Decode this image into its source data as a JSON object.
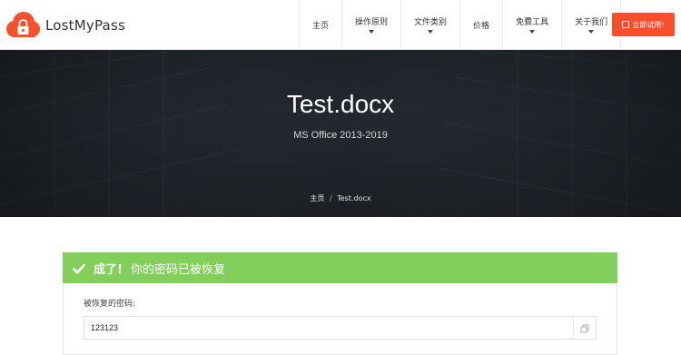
{
  "brand": {
    "name": "LostMyPass",
    "accent": "#f4512c"
  },
  "nav": {
    "items": [
      {
        "label": "主页",
        "dropdown": false
      },
      {
        "label": "操作原则",
        "dropdown": true
      },
      {
        "label": "文件类别",
        "dropdown": true
      },
      {
        "label": "价格",
        "dropdown": false
      },
      {
        "label": "免費工具",
        "dropdown": true
      },
      {
        "label": "关于我们",
        "dropdown": true
      }
    ],
    "cta_label": "立即试用!"
  },
  "hero": {
    "title": "Test.docx",
    "subtitle": "MS Office 2013-2019",
    "breadcrumb": {
      "home": "主页",
      "separator": "/",
      "current": "Test.docx"
    }
  },
  "result": {
    "status": "成了!",
    "message": "你的密码已被恢复",
    "status_color": "#82cf5c",
    "field_label": "被恢复的密码:",
    "password": "123123",
    "copy_icon": "copy-icon"
  }
}
